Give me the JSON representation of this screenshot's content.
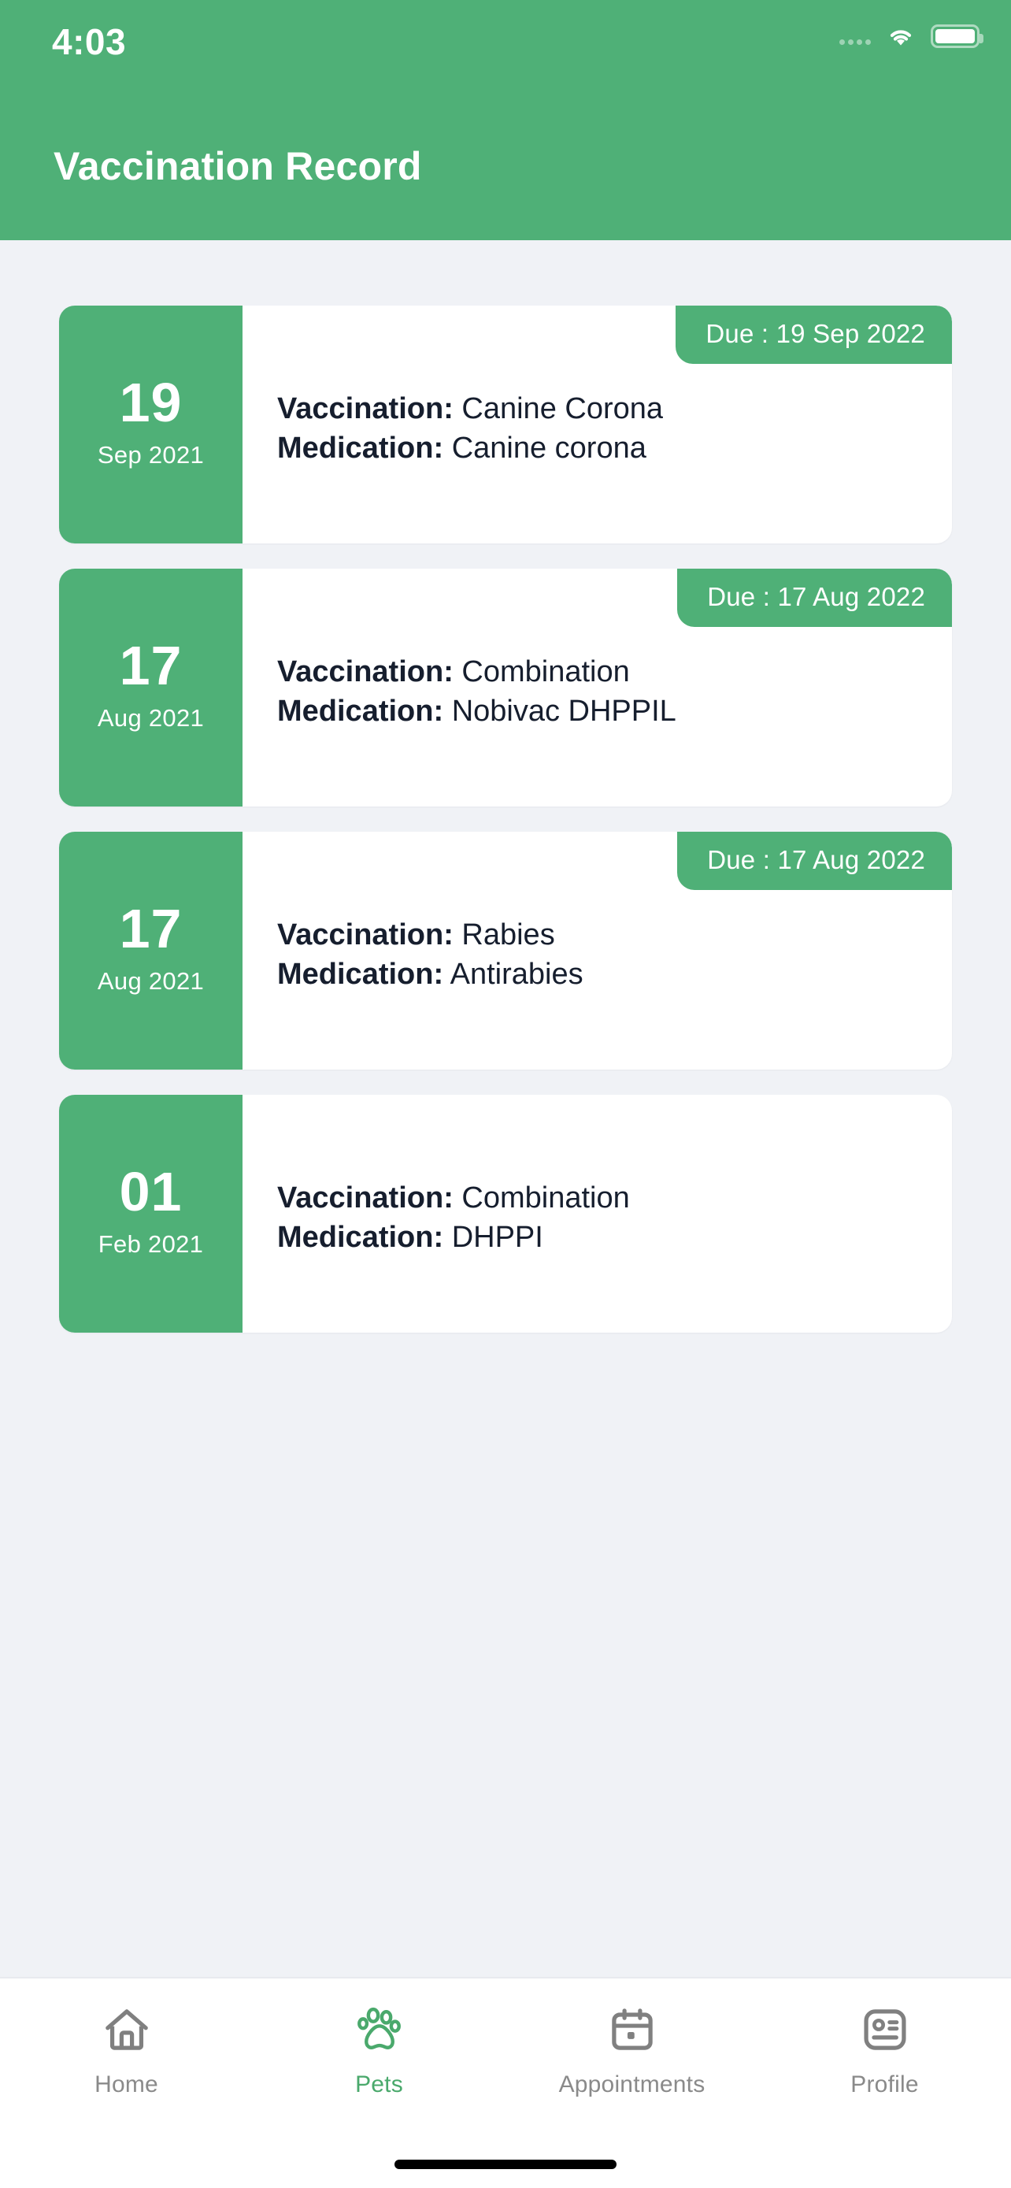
{
  "status_bar": {
    "time": "4:03",
    "wifi_icon": "wifi-icon",
    "battery_icon": "battery-icon",
    "signal_icon": "signal-dots-icon"
  },
  "header": {
    "title": "Vaccination Record",
    "background_color": "#4FB077"
  },
  "theme": {
    "accent": "#4FB077",
    "page_background": "#F0F2F6",
    "card_background": "#FFFFFF",
    "text_primary": "#161E2E",
    "tab_inactive": "#8A8A8A",
    "tab_active": "#4AA96C"
  },
  "labels": {
    "vaccination": "Vaccination:",
    "medication": "Medication:",
    "due_prefix": "Due : "
  },
  "records": [
    {
      "day": "19",
      "month_year": "Sep 2021",
      "due": "Due : 19 Sep 2022",
      "vaccination_label": "Vaccination:",
      "vaccination_value": "Canine Corona",
      "medication_label": "Medication:",
      "medication_value": "Canine corona"
    },
    {
      "day": "17",
      "month_year": "Aug 2021",
      "due": "Due : 17 Aug 2022",
      "vaccination_label": "Vaccination:",
      "vaccination_value": "Combination",
      "medication_label": "Medication:",
      "medication_value": "Nobivac DHPPIL"
    },
    {
      "day": "17",
      "month_year": "Aug 2021",
      "due": "Due : 17 Aug 2022",
      "vaccination_label": "Vaccination:",
      "vaccination_value": "Rabies",
      "medication_label": "Medication:",
      "medication_value": "Antirabies"
    },
    {
      "day": "01",
      "month_year": "Feb 2021",
      "due": "",
      "vaccination_label": "Vaccination:",
      "vaccination_value": "Combination",
      "medication_label": "Medication:",
      "medication_value": "DHPPI"
    }
  ],
  "tabbar": {
    "items": [
      {
        "label": "Home",
        "icon": "home-icon",
        "active": false
      },
      {
        "label": "Pets",
        "icon": "paw-icon",
        "active": true
      },
      {
        "label": "Appointments",
        "icon": "calendar-icon",
        "active": false
      },
      {
        "label": "Profile",
        "icon": "id-card-icon",
        "active": false
      }
    ]
  }
}
